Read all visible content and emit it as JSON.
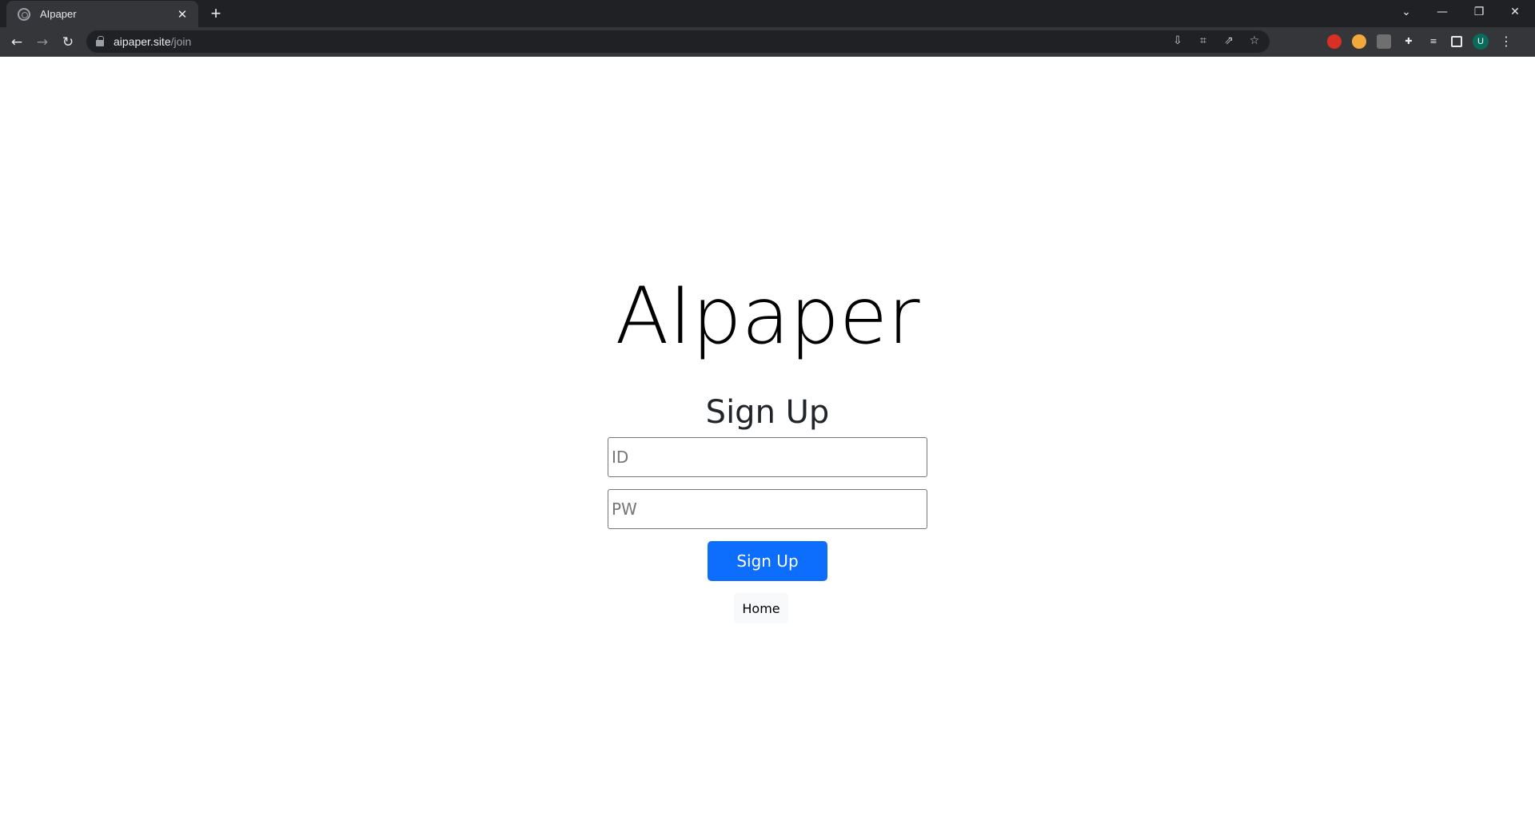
{
  "browser": {
    "tab": {
      "title": "AIpaper",
      "close_glyph": "✕",
      "favicon": "openai-favicon"
    },
    "new_tab_glyph": "+",
    "window_controls": {
      "tab_search": "⌄",
      "minimize": "—",
      "restore": "❐",
      "close": "✕"
    },
    "nav": {
      "back": "←",
      "forward": "→",
      "reload": "↻"
    },
    "address": {
      "host": "aipaper.site",
      "path": "/join"
    },
    "omnibox_icons": [
      "install-icon",
      "translate-icon",
      "share-icon",
      "bookmark-star-icon"
    ],
    "extensions": {
      "profile_initial": "U"
    }
  },
  "page": {
    "brand_title": "AIpaper",
    "heading": "Sign Up",
    "id_field": {
      "placeholder": "ID",
      "value": ""
    },
    "pw_field": {
      "placeholder": "PW",
      "value": ""
    },
    "submit_label": "Sign Up",
    "home_label": "Home"
  },
  "colors": {
    "primary_button": "#0d6efd",
    "home_button_bg": "#f8f9fa",
    "chrome_dark": "#202124",
    "toolbar": "#35363a"
  }
}
